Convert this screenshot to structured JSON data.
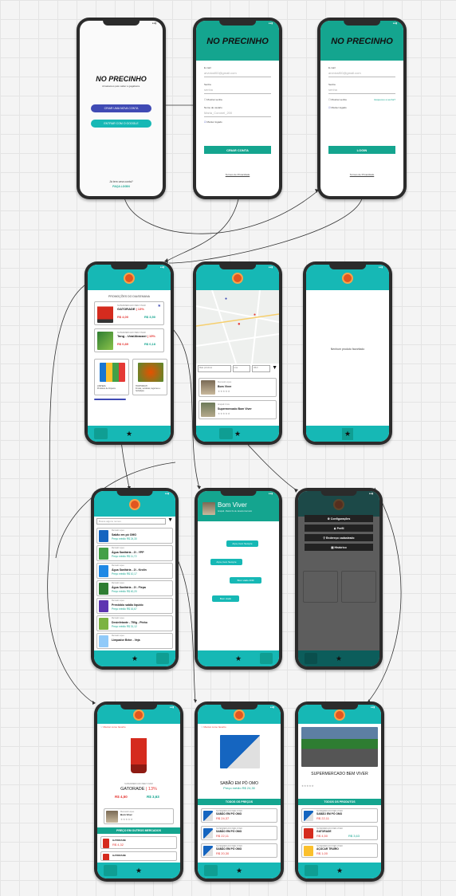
{
  "brand": "NO PRECINHO",
  "s1": {
    "tagline": "Arrastamos pelo saber é gagabeira.",
    "btn_create": "CRIAR UMA NOVA CONTA",
    "btn_google": "ENTRAR COM O GOOGLE",
    "has_account": "Já tem uma conta?",
    "login_link": "FAÇA LOGIN"
  },
  "s2": {
    "email_label": "E-mail",
    "email_value": "arvidosf00@gmail.com",
    "pass_label": "Senha",
    "pass_value": "senha",
    "show_pass": "Mostrar senha",
    "user_label": "Nome de usuário",
    "user_value": "Maria_Coronel_200",
    "keep": "Manter logado",
    "btn": "CRIAR CONTA",
    "terms": "Termos de Privacidade"
  },
  "s3": {
    "email_label": "E-mail",
    "email_value": "arvidosf00@gmail.com",
    "pass_label": "Senha",
    "pass_value": "senha",
    "show_pass": "Mostrar senha",
    "forgot": "Esqueceu a senha?",
    "keep": "Manter logado",
    "btn": "LOGIN",
    "terms": "Termos de Privacidade"
  },
  "s4": {
    "heading": "PROMOÇÕES DO DIA/SEMANA",
    "p1": {
      "store": "SUPERMERCADO BEM VIVER",
      "name": "GATORADE",
      "disc": "| 13%",
      "old": "R$ 4,00",
      "new": "R$ 3,50"
    },
    "p2": {
      "store": "SUPERMERCADO BEM VIVER",
      "name": "Tang - Uva/Abacaxi",
      "disc": "| 15%",
      "old": "R$ 0,89",
      "new": "R$ 0,18"
    },
    "c1": "LIMPEZA\nProdutos de limpeza",
    "c2": "HORTIFRUTI\nFrutas, verduras, legumes e hortaliças"
  },
  "s5": {
    "f1": "Mais próximos",
    "f2": "Uva",
    "f3": "R$ 0",
    "r1": {
      "a": "Mercado Lopes",
      "b": "Bom Viver"
    },
    "r2": {
      "a": "Arapuã 4 rios",
      "b": "Supermercado Bom Viver"
    }
  },
  "s6": {
    "empty": "Nenhum produto favoritado"
  },
  "s7": {
    "search": "Busca alguns nomes",
    "items": [
      {
        "store": "Mercado Lopes",
        "name": "Sabão em pó OMO",
        "price": "Preço médio R$ 24,30"
      },
      {
        "store": "Mercado Lopes",
        "name": "Água Sanitária - 2l - YPP",
        "price": "Preço médio R$ 11,72"
      },
      {
        "store": "Mercado Lopes",
        "name": "Água Sanitária - 2l - Krolin",
        "price": "Preço médio R$ 10,17"
      },
      {
        "store": "Mercado Lopes",
        "name": "Água Sanitária - 2l - Fiepa",
        "price": "Preço médio R$ 40,20"
      },
      {
        "store": "Mercado Lopes",
        "name": "Prestóbio sabão líquido",
        "price": "Preço médio R$ 16,67"
      },
      {
        "store": "Mercado Lopes",
        "name": "Desinfetante - 750g - Pinho",
        "price": "Preço médio R$ 31,12"
      },
      {
        "store": "Mercado Lopes",
        "name": "Limpador Bebe - Veja",
        "price": ""
      }
    ]
  },
  "s8": {
    "name": "Bom Viver",
    "sub": "Arapuã - Bairro fio de Janeiro-Cerneiro",
    "b1": "Arpa, bem Sempre",
    "b2": "Arpa, bem Sempre",
    "b3": "Bom viado 4/30",
    "b4": "Bom viado"
  },
  "s9": {
    "m1": "Configurações",
    "m2": "Perfil",
    "m3": "Endereço cadastrado",
    "m4": "Histórico"
  },
  "s10": {
    "fav": "Marcar como favorito",
    "store": "SUPERMERCADO BEM VIVER",
    "name": "GATORADE",
    "disc": "| 13%",
    "old": "R$ 4,50",
    "new": "R$ 3,63",
    "shop": "Mercado Lopes",
    "shop_name": "Bom Viver",
    "section": "PREÇO EM OUTROS MERCADOS",
    "o1": {
      "name": "GATORADE",
      "price": "R$ 4,32"
    },
    "o2": {
      "name": "GATORADE",
      "price": ""
    }
  },
  "s11": {
    "fav": "Marcar como favorito",
    "title": "SABÃO EM PÓ OMO",
    "avg": "Preço médio R$ 24,30",
    "section": "TODOS OS PREÇOS",
    "rows": [
      {
        "store": "SUPERMERCADO BEM VIVER",
        "name": "SABÃO EM PÓ OMO",
        "price": "R$ 24,37"
      },
      {
        "store": "SUPERMERCADO BEM VIVER",
        "name": "SABÃO EM PÓ OMO",
        "price": "R$ 22,11"
      },
      {
        "store": "SUPERMERCADO BEM VIVER",
        "name": "SABÃO EM PÓ OMO",
        "price": "R$ 20,30"
      }
    ]
  },
  "s12": {
    "title": "SUPERMERCADO BEM VIVER",
    "section": "TODOS OS PRODUTOS",
    "rows": [
      {
        "store": "SUPERMERCADO BEM VIVER",
        "name": "SABÃO EM PÓ OMO",
        "price": "R$ 22,11"
      },
      {
        "store": "SUPERMERCADO BEM VIVER",
        "name": "GATORADE",
        "old": "R$ 4,50",
        "price": "R$ 3,63"
      },
      {
        "store": "SUPERMERCADO BEM VIVER",
        "name": "AÇÚCAR TRUÍRO",
        "price": "R$ 1,00"
      }
    ]
  },
  "colors": {
    "teal": "#16b8b5",
    "green": "#14a58f",
    "red": "#e53935",
    "blue": "#3f4ab4",
    "orange": "#e2561f"
  }
}
